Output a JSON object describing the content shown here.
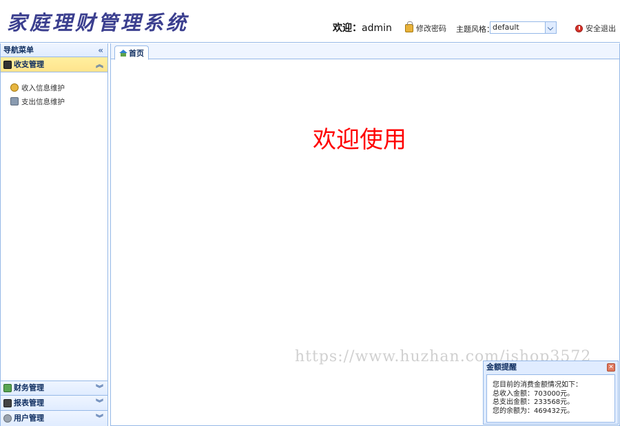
{
  "header": {
    "logo": "家庭理财管理系统",
    "welcome_label": "欢迎：",
    "username": "admin",
    "change_password": "修改密码",
    "theme_label": "主题风格：",
    "theme_value": "default",
    "logout": "安全退出"
  },
  "sidebar": {
    "title": "导航菜单",
    "active_section": "收支管理",
    "items": [
      {
        "label": "收入信息维护",
        "icon": "coins-icon"
      },
      {
        "label": "支出信息维护",
        "icon": "expense-icon"
      }
    ],
    "sections": [
      {
        "label": "财务管理",
        "icon": "finance-icon"
      },
      {
        "label": "报表管理",
        "icon": "report-icon"
      },
      {
        "label": "用户管理",
        "icon": "user-gear-icon"
      }
    ]
  },
  "main": {
    "tab_label": "首页",
    "welcome_text": "欢迎使用"
  },
  "watermark": "https://www.huzhan.com/ishop3572",
  "popup": {
    "title": "金额提醒",
    "lines": [
      "您目前的消费金额情况如下：",
      "总收入金额：703000元。",
      "总支出金额：233568元。",
      "您的余额为：469432元。"
    ]
  },
  "colors": {
    "border": "#95b8e7",
    "panel_header": "#e0ecff",
    "active_header": "#ffe48d",
    "welcome_text": "#ff0000",
    "logo": "#3b3f8f"
  }
}
